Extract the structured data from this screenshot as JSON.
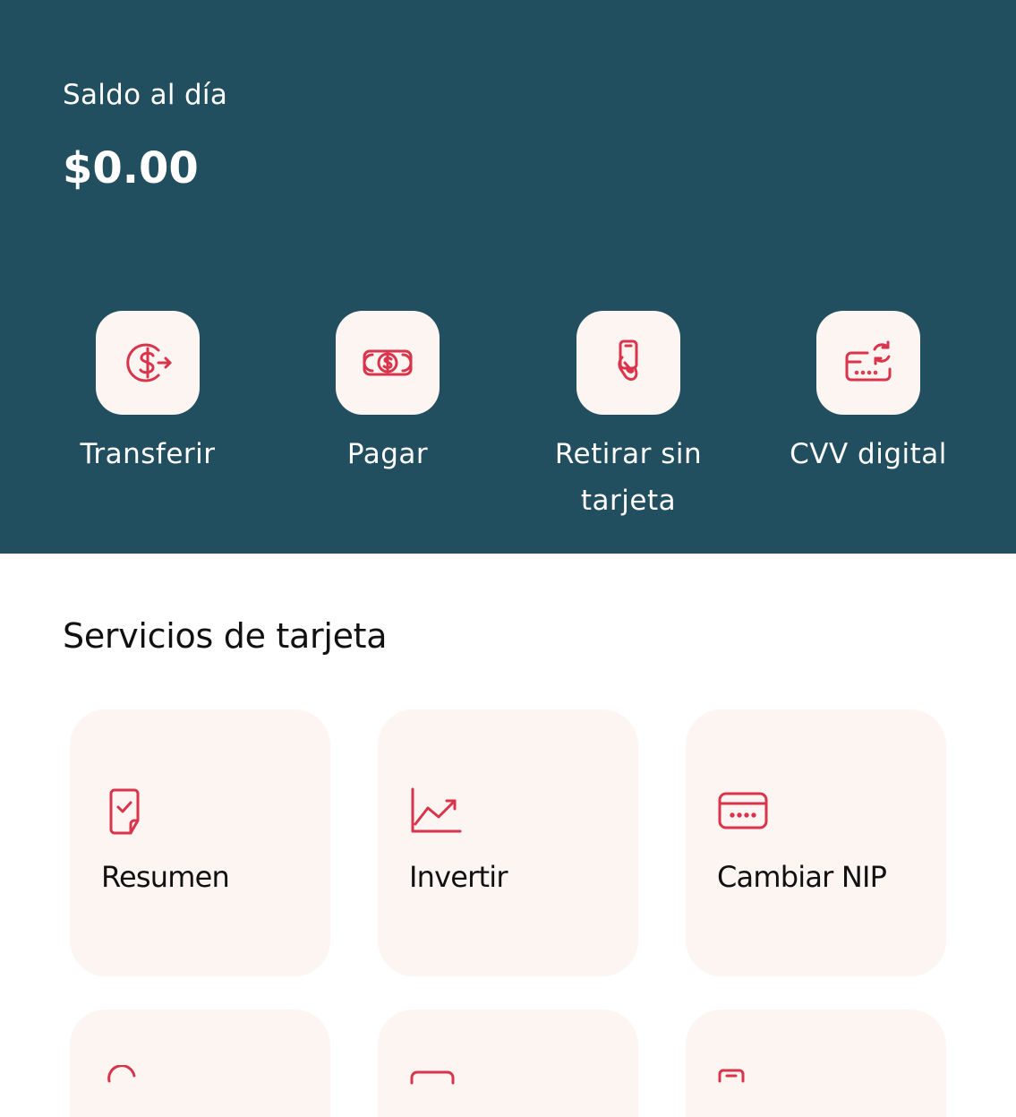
{
  "colors": {
    "hero_bg": "#214f5f",
    "accent": "#d9344b",
    "tile_bg": "#fdf5f2"
  },
  "balance": {
    "label": "Saldo al día",
    "amount": "$0.00"
  },
  "actions": [
    {
      "label": "Transferir",
      "icon": "transfer-dollar-icon"
    },
    {
      "label": "Pagar",
      "icon": "banknote-icon"
    },
    {
      "label": "Retirar sin tarjeta",
      "icon": "hand-phone-icon"
    },
    {
      "label": "CVV digital",
      "icon": "card-refresh-icon"
    }
  ],
  "card_services": {
    "title": "Servicios de tarjeta",
    "items": [
      {
        "label": "Resumen",
        "icon": "document-check-icon"
      },
      {
        "label": "Invertir",
        "icon": "trend-chart-icon"
      },
      {
        "label": "Cambiar NIP",
        "icon": "card-pin-icon"
      }
    ]
  }
}
